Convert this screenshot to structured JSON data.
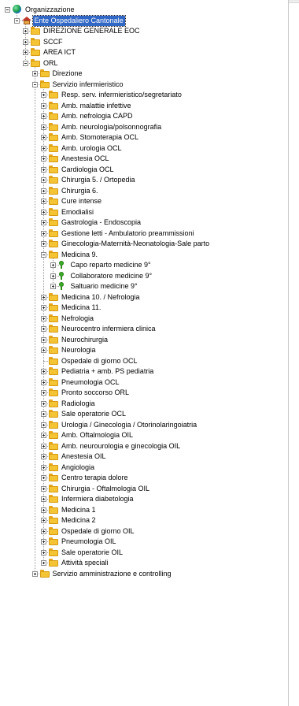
{
  "tree": [
    {
      "text": "Organizzazione",
      "depth": 0,
      "icon": "globe",
      "expander": "minus"
    },
    {
      "text": "Ente Ospedaliero Cantonale",
      "depth": 1,
      "icon": "building",
      "expander": "minus",
      "selected": true
    },
    {
      "text": "DIREZIONE GENERALE EOC",
      "depth": 2,
      "icon": "folder",
      "expander": "plus"
    },
    {
      "text": "SCCF",
      "depth": 2,
      "icon": "folder",
      "expander": "plus"
    },
    {
      "text": "AREA ICT",
      "depth": 2,
      "icon": "folder",
      "expander": "plus"
    },
    {
      "text": "ORL",
      "depth": 2,
      "icon": "folder",
      "expander": "minus"
    },
    {
      "text": "Direzione",
      "depth": 3,
      "icon": "folder",
      "expander": "plus"
    },
    {
      "text": "Servizio infermieristico",
      "depth": 3,
      "icon": "folder",
      "expander": "minus"
    },
    {
      "text": "Resp. serv. infermieristico/segretariato",
      "depth": 4,
      "icon": "folder",
      "expander": "plus"
    },
    {
      "text": "Amb. malattie infettive",
      "depth": 4,
      "icon": "folder",
      "expander": "plus"
    },
    {
      "text": "Amb. nefrologia CAPD",
      "depth": 4,
      "icon": "folder",
      "expander": "plus"
    },
    {
      "text": "Amb. neurologia/polsonnografia",
      "depth": 4,
      "icon": "folder",
      "expander": "plus"
    },
    {
      "text": "Amb. Stomoterapia OCL",
      "depth": 4,
      "icon": "folder",
      "expander": "plus"
    },
    {
      "text": "Amb. urologia OCL",
      "depth": 4,
      "icon": "folder",
      "expander": "plus"
    },
    {
      "text": "Anestesia OCL",
      "depth": 4,
      "icon": "folder",
      "expander": "plus"
    },
    {
      "text": "Cardiologia OCL",
      "depth": 4,
      "icon": "folder",
      "expander": "plus"
    },
    {
      "text": "Chirurgia 5. / Ortopedia",
      "depth": 4,
      "icon": "folder",
      "expander": "plus"
    },
    {
      "text": "Chirurgia 6.",
      "depth": 4,
      "icon": "folder",
      "expander": "plus"
    },
    {
      "text": "Cure intense",
      "depth": 4,
      "icon": "folder",
      "expander": "plus"
    },
    {
      "text": "Emodialisi",
      "depth": 4,
      "icon": "folder",
      "expander": "plus"
    },
    {
      "text": "Gastrologia - Endoscopia",
      "depth": 4,
      "icon": "folder",
      "expander": "plus"
    },
    {
      "text": "Gestione letti - Ambulatorio preammissioni",
      "depth": 4,
      "icon": "folder",
      "expander": "plus"
    },
    {
      "text": "Ginecologia-Maternità-Neonatologia-Sale parto",
      "depth": 4,
      "icon": "folder",
      "expander": "plus"
    },
    {
      "text": "Medicina 9.",
      "depth": 4,
      "icon": "folder",
      "expander": "minus"
    },
    {
      "text": "Capo reparto medicine 9°",
      "depth": 5,
      "icon": "pin",
      "expander": "plus"
    },
    {
      "text": "Collaboratore medicine 9°",
      "depth": 5,
      "icon": "pin",
      "expander": "plus"
    },
    {
      "text": "Saltuario medicine 9°",
      "depth": 5,
      "icon": "pin",
      "expander": "plus"
    },
    {
      "text": "Medicina 10. / Nefrologia",
      "depth": 4,
      "icon": "folder",
      "expander": "plus"
    },
    {
      "text": "Medicina 11.",
      "depth": 4,
      "icon": "folder",
      "expander": "plus"
    },
    {
      "text": "Nefrologia",
      "depth": 4,
      "icon": "folder",
      "expander": "plus"
    },
    {
      "text": "Neurocentro infermiera clinica",
      "depth": 4,
      "icon": "folder",
      "expander": "plus"
    },
    {
      "text": "Neurochirurgia",
      "depth": 4,
      "icon": "folder",
      "expander": "plus"
    },
    {
      "text": "Neurologia",
      "depth": 4,
      "icon": "folder",
      "expander": "plus"
    },
    {
      "text": "Ospedale di giorno OCL",
      "depth": 4,
      "icon": "folder",
      "expander": "none"
    },
    {
      "text": "Pediatria + amb. PS pediatria",
      "depth": 4,
      "icon": "folder",
      "expander": "plus"
    },
    {
      "text": "Pneumologia OCL",
      "depth": 4,
      "icon": "folder",
      "expander": "plus"
    },
    {
      "text": "Pronto soccorso ORL",
      "depth": 4,
      "icon": "folder",
      "expander": "plus"
    },
    {
      "text": "Radiologia",
      "depth": 4,
      "icon": "folder",
      "expander": "plus"
    },
    {
      "text": "Sale operatorie OCL",
      "depth": 4,
      "icon": "folder",
      "expander": "plus"
    },
    {
      "text": "Urologia / Ginecologia / Otorinolaringoiatria",
      "depth": 4,
      "icon": "folder",
      "expander": "plus"
    },
    {
      "text": "Amb. Oftalmologia OIL",
      "depth": 4,
      "icon": "folder",
      "expander": "plus"
    },
    {
      "text": "Amb. neurourologia e ginecologia OIL",
      "depth": 4,
      "icon": "folder",
      "expander": "plus"
    },
    {
      "text": "Anestesia OIL",
      "depth": 4,
      "icon": "folder",
      "expander": "plus"
    },
    {
      "text": "Angiologia",
      "depth": 4,
      "icon": "folder",
      "expander": "plus"
    },
    {
      "text": "Centro terapia dolore",
      "depth": 4,
      "icon": "folder",
      "expander": "plus"
    },
    {
      "text": "Chirurgia - Oftalmologia OIL",
      "depth": 4,
      "icon": "folder",
      "expander": "plus"
    },
    {
      "text": "Infermiera diabetologia",
      "depth": 4,
      "icon": "folder",
      "expander": "plus"
    },
    {
      "text": "Medicina 1",
      "depth": 4,
      "icon": "folder",
      "expander": "plus"
    },
    {
      "text": "Medicina 2",
      "depth": 4,
      "icon": "folder",
      "expander": "plus"
    },
    {
      "text": "Ospedale di giorno OIL",
      "depth": 4,
      "icon": "folder",
      "expander": "plus"
    },
    {
      "text": "Pneumologia OIL",
      "depth": 4,
      "icon": "folder",
      "expander": "plus"
    },
    {
      "text": "Sale operatorie OIL",
      "depth": 4,
      "icon": "folder",
      "expander": "plus"
    },
    {
      "text": "Attività speciali",
      "depth": 4,
      "icon": "folder",
      "expander": "plus"
    },
    {
      "text": "Servizio amministrazione e controlling",
      "depth": 3,
      "icon": "folder",
      "expander": "plus"
    }
  ]
}
